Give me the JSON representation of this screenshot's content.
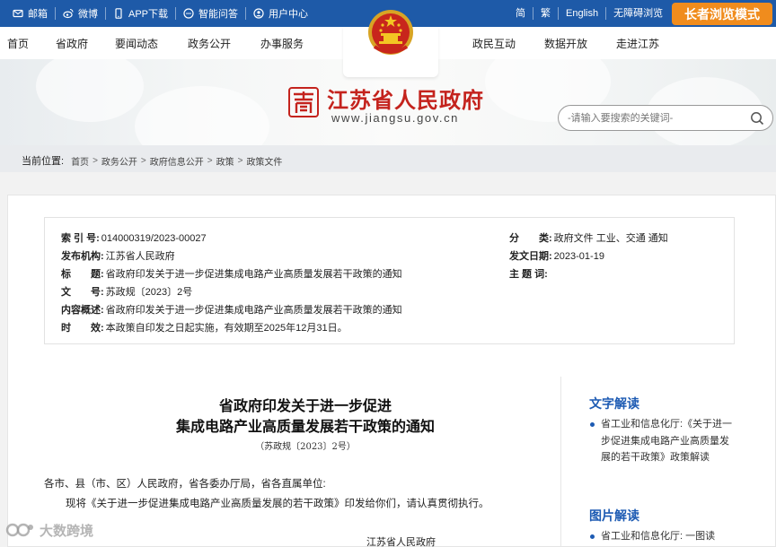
{
  "topbar": {
    "left_links": [
      {
        "label": "邮箱",
        "icon": "mail-icon"
      },
      {
        "label": "微博",
        "icon": "weibo-icon"
      },
      {
        "label": "APP下载",
        "icon": "phone-icon"
      },
      {
        "label": "智能问答",
        "icon": "chat-icon"
      },
      {
        "label": "用户中心",
        "icon": "user-icon"
      }
    ],
    "right_links": [
      "简",
      "繁",
      "English",
      "无障碍浏览"
    ],
    "elder_mode": "长者浏览模式"
  },
  "nav": {
    "left": [
      "首页",
      "省政府",
      "要闻动态",
      "政务公开",
      "办事服务"
    ],
    "right": [
      "政民互动",
      "数据开放",
      "走进江苏"
    ]
  },
  "banner": {
    "site_name": "江苏省人民政府",
    "site_url": "www.jiangsu.gov.cn",
    "search_placeholder": "-请输入要搜索的关键词-"
  },
  "breadcrumb": {
    "label": "当前位置:",
    "items": [
      "首页",
      "政务公开",
      "政府信息公开",
      "政策",
      "政策文件"
    ]
  },
  "meta": {
    "index_no": {
      "k": "索 引 号:",
      "v": "014000319/2023-00027"
    },
    "issuer": {
      "k": "发布机构:",
      "v": "江苏省人民政府"
    },
    "title": {
      "k": "标　　题:",
      "v": "省政府印发关于进一步促进集成电路产业高质量发展若干政策的通知"
    },
    "doc_no": {
      "k": "文　　号:",
      "v": "苏政规〔2023〕2号"
    },
    "summary": {
      "k": "内容概述:",
      "v": "省政府印发关于进一步促进集成电路产业高质量发展若干政策的通知"
    },
    "validity": {
      "k": "时　　效:",
      "v": "本政策自印发之日起实施，有效期至2025年12月31日。"
    },
    "category": {
      "k": "分　　类:",
      "v": "政府文件 工业、交通 通知"
    },
    "issue_date": {
      "k": "发文日期:",
      "v": "2023-01-19"
    },
    "subject": {
      "k": "主 题 词:",
      "v": ""
    }
  },
  "document": {
    "title_line1": "省政府印发关于进一步促进",
    "title_line2": "集成电路产业高质量发展若干政策的通知",
    "doc_no": "（苏政规〔2023〕2号）",
    "para1": "各市、县（市、区）人民政府，省各委办厅局，省各直属单位:",
    "para2": "现将《关于进一步促进集成电路产业高质量发展的若干政策》印发给你们，请认真贯彻执行。",
    "signature": "江苏省人民政府"
  },
  "sidebar": {
    "text_heading": "文字解读",
    "text_item": "省工业和信息化厅:《关于进一步促进集成电路产业高质量发展的若干政策》政策解读",
    "image_heading": "图片解读",
    "image_item": "省工业和信息化厅: 一图读"
  },
  "watermark": "大数跨境",
  "colors": {
    "primary": "#1e5aa8",
    "accent": "#f08c1d",
    "brand_red": "#c4231d"
  }
}
